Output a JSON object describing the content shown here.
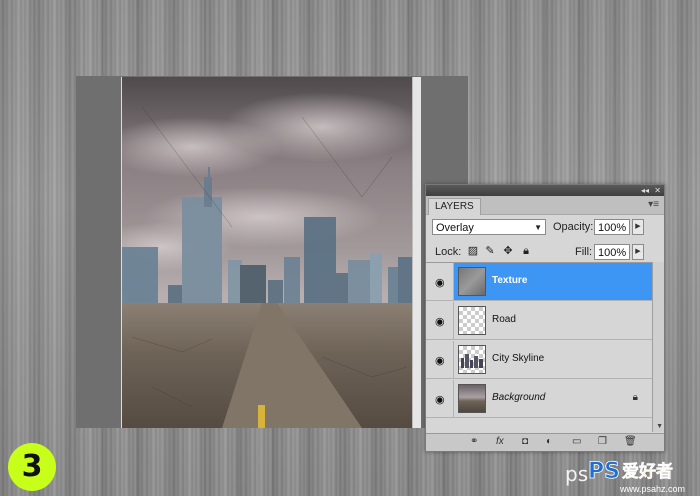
{
  "canvas": {
    "description_layers": [
      "sky",
      "city-skyline",
      "road",
      "texture"
    ]
  },
  "layers_panel": {
    "tab_label": "LAYERS",
    "blend_mode": "Overlay",
    "opacity_label": "Opacity:",
    "opacity_value": "100%",
    "lock_label": "Lock:",
    "fill_label": "Fill:",
    "fill_value": "100%",
    "layers": [
      {
        "name": "Texture",
        "selected": true
      },
      {
        "name": "Road",
        "selected": false
      },
      {
        "name": "City Skyline",
        "selected": false
      },
      {
        "name": "Background",
        "selected": false,
        "locked": true
      }
    ]
  },
  "step_badge": "3",
  "watermark": {
    "text": "ps",
    "logo_text": "PS爱好者",
    "url": "www.psahz.com"
  },
  "colors": {
    "selected_layer": "#3d96f3",
    "badge": "#c8ff1a"
  }
}
